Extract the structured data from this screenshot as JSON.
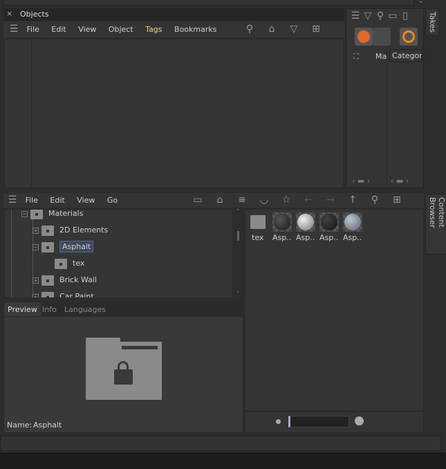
{
  "objects_panel": {
    "title": "Objects",
    "menu": [
      "File",
      "Edit",
      "View",
      "Object",
      "Tags",
      "Bookmarks"
    ],
    "tags_color": "#e8d77a"
  },
  "takes_panel": {
    "tab": "Takes",
    "tree_item": "Ma",
    "column": "Category"
  },
  "content_browser": {
    "tab": "Content Browser",
    "menu": [
      "File",
      "Edit",
      "View",
      "Go"
    ],
    "tree": [
      {
        "label": "Materials",
        "expanded": true
      },
      {
        "label": "2D Elements",
        "expanded": false
      },
      {
        "label": "Asphalt",
        "expanded": true,
        "selected": true
      },
      {
        "label": "tex"
      },
      {
        "label": "Brick Wall",
        "expanded": false
      },
      {
        "label": "Car Paint",
        "expanded": false
      }
    ],
    "tabs": [
      "Preview",
      "Info",
      "Languages"
    ],
    "active_tab": "Preview",
    "preview_name_label": "Name:",
    "preview_name": "Asphalt",
    "items": [
      {
        "label": "tex",
        "type": "folder"
      },
      {
        "label": "Asp..",
        "type": "material",
        "color": "#2a2a2a"
      },
      {
        "label": "Asp..",
        "type": "material",
        "color": "#cfcfcf"
      },
      {
        "label": "Asp..",
        "type": "material",
        "color": "#1e1e1e"
      },
      {
        "label": "Asp..",
        "type": "material",
        "color": "#9aa3ad"
      }
    ]
  }
}
